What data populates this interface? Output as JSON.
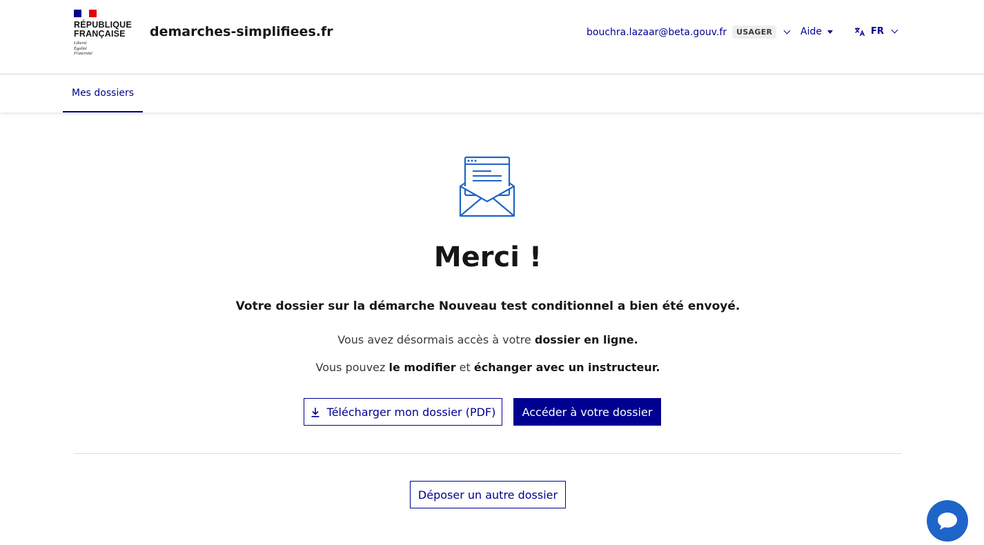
{
  "header": {
    "logo": {
      "line1": "RÉPUBLIQUE",
      "line2": "FRANÇAISE",
      "motto1": "Liberté",
      "motto2": "Égalité",
      "motto3": "Fraternité",
      "flag_colors": [
        "#000091",
        "#ffffff",
        "#e1000f"
      ]
    },
    "site_title": "demarches-simplifiees.fr",
    "user_email": "bouchra.lazaar@beta.gouv.fr",
    "user_badge": "USAGER",
    "help_label": "Aide",
    "language": "FR"
  },
  "nav": {
    "items": [
      {
        "label": "Mes dossiers",
        "active": true
      }
    ]
  },
  "main": {
    "icon": "envelope-icon",
    "title": "Merci !",
    "confirmation": "Votre dossier sur la démarche Nouveau test conditionnel a bien été envoyé.",
    "access_prefix": "Vous avez désormais accès à votre ",
    "access_strong": "dossier en ligne.",
    "modify_prefix": "Vous pouvez ",
    "modify_strong1": "le modifier",
    "modify_mid": " et ",
    "modify_strong2": "échanger avec un instructeur.",
    "download_button": "Télécharger mon dossier (PDF)",
    "access_button": "Accéder à votre dossier",
    "other_button": "Déposer un autre dossier"
  },
  "colors": {
    "brand_blue": "#000091",
    "chat_blue": "#1f64c8",
    "marianne_red": "#e1000f"
  }
}
